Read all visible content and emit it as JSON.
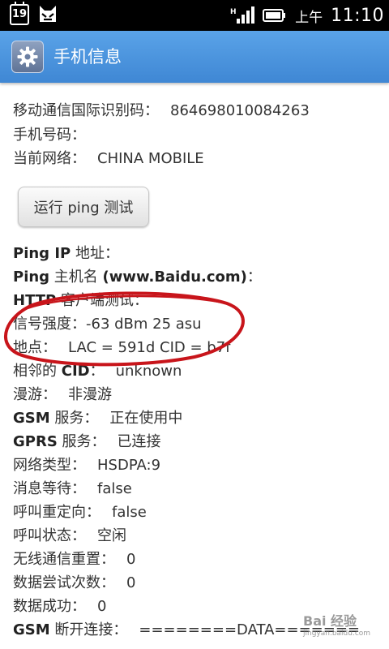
{
  "status_bar": {
    "calendar_day": "19",
    "ampm": "上午",
    "time": "11:10"
  },
  "titlebar": {
    "title": "手机信息"
  },
  "content": {
    "imei_label": "移动通信国际识别码：",
    "imei_value": "864698010084263",
    "phone_label": "手机号码：",
    "phone_value": "",
    "network_label": "当前网络：",
    "network_value": "CHINA  MOBILE",
    "ping_button": "运行 ping 测试",
    "ping_ip_bold": "Ping IP",
    "ping_ip_rest": " 地址：",
    "ping_host_bold": "Ping",
    "ping_host_rest": " 主机名 ",
    "ping_host_url": "(www.Baidu.com)",
    "ping_host_colon": "：",
    "http_bold": "HTTP",
    "http_rest": " 客户端测试：",
    "signal_label": "信号强度：",
    "signal_value": "-63 dBm   25 asu",
    "location_label": "地点：",
    "location_value": "LAC = 591d   CID = b7f",
    "neighbor_label_a": "相邻的 ",
    "neighbor_label_b": "CID",
    "neighbor_label_c": "：",
    "neighbor_value": "unknown",
    "roaming_label": "漫游：",
    "roaming_value": "非漫游",
    "gsm_bold": "GSM",
    "gsm_rest": " 服务：",
    "gsm_value": "正在使用中",
    "gprs_bold": "GPRS",
    "gprs_rest": " 服务：",
    "gprs_value": "已连接",
    "nettype_label": "网络类型：",
    "nettype_value": "HSDPA:9",
    "msgwait_label": "消息等待：",
    "msgwait_value": "false",
    "callredirect_label": "呼叫重定向：",
    "callredirect_value": "false",
    "callstate_label": "呼叫状态：",
    "callstate_value": "空闲",
    "radioreset_label": "无线通信重置：",
    "radioreset_value": "0",
    "dataattempt_label": "数据尝试次数：",
    "dataattempt_value": "0",
    "datasuccess_label": "数据成功：",
    "datasuccess_value": "0",
    "gsmdisc_bold": "GSM",
    "gsmdisc_rest": " 断开连接：",
    "gsmdisc_value": "========DATA======="
  },
  "watermark": {
    "text": "Bai 经验",
    "subtext": "jingyan.baidu.com"
  },
  "colors": {
    "titlebar": "#4a94dd",
    "annotation": "#c8151b"
  }
}
